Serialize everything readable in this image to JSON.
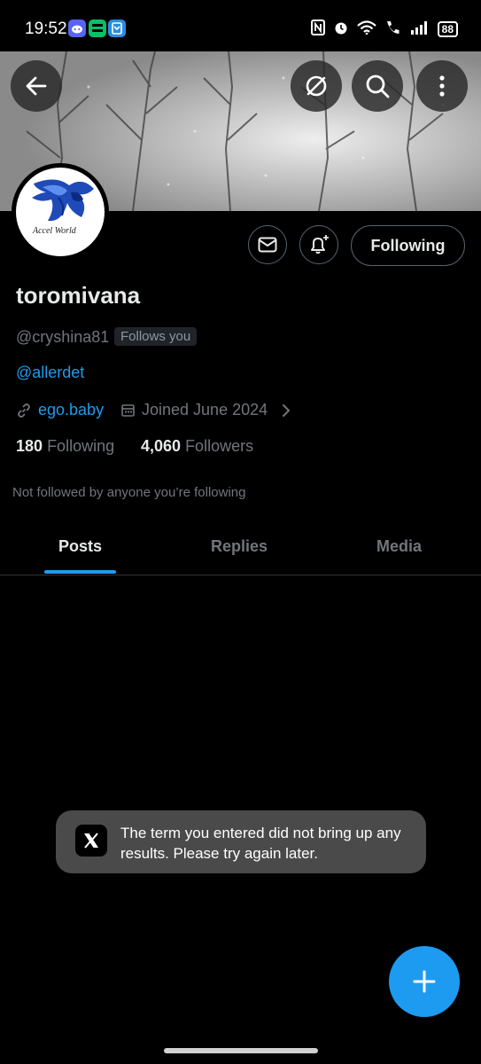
{
  "status_bar": {
    "time": "19:52",
    "battery": "88"
  },
  "profile": {
    "display_name": "toromivana",
    "handle": "@cryshina81",
    "follows_you_badge": "Follows you",
    "bio": "@allerdet",
    "link": "ego.baby",
    "joined": "Joined June 2024",
    "following_count": "180",
    "following_label": "Following",
    "followers_count": "4,060",
    "followers_label": "Followers",
    "social_context": "Not followed by anyone you’re following",
    "avatar_text": "Accel World"
  },
  "actions": {
    "follow_button": "Following"
  },
  "tabs": [
    {
      "label": "Posts",
      "active": true
    },
    {
      "label": "Replies",
      "active": false
    },
    {
      "label": "Media",
      "active": false
    }
  ],
  "toast": {
    "message": "The term you entered did not bring up any results. Please try again later."
  },
  "colors": {
    "accent": "#1d9bf0",
    "background": "#000000",
    "muted": "#71767b"
  },
  "icons": [
    "back-arrow-icon",
    "grok-icon",
    "search-icon",
    "more-vertical-icon",
    "message-icon",
    "notification-bell-icon",
    "link-icon",
    "calendar-icon",
    "chevron-right-icon",
    "x-logo-icon",
    "plus-icon"
  ]
}
